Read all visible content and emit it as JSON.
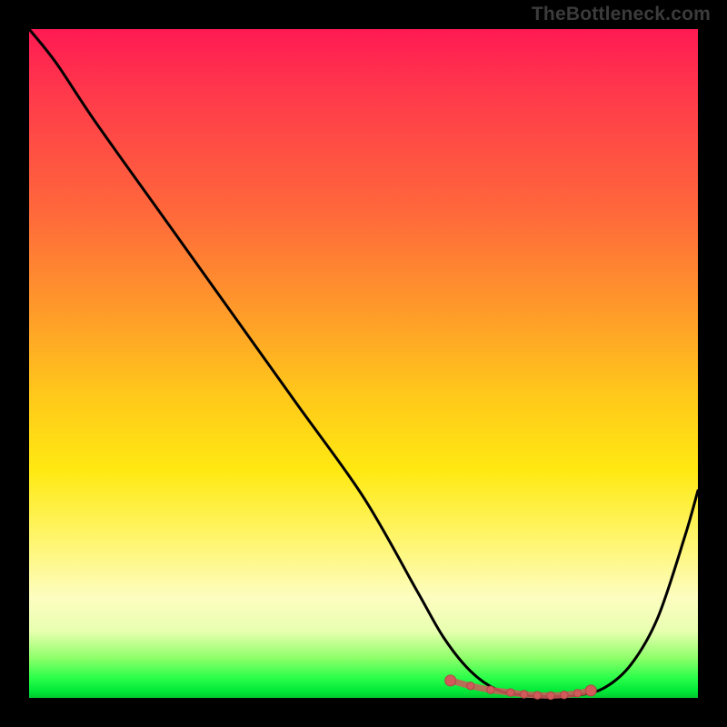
{
  "watermark": "TheBottleneck.com",
  "colors": {
    "page_bg": "#000000",
    "curve": "#000000",
    "marker_fill": "#d15a5a",
    "marker_stroke": "#b04646",
    "gradient_top": "#ff1a53",
    "gradient_bottom": "#00c830"
  },
  "chart_data": {
    "type": "line",
    "title": "",
    "xlabel": "",
    "ylabel": "",
    "xlim": [
      0,
      100
    ],
    "ylim": [
      0,
      100
    ],
    "grid": false,
    "legend": false,
    "series": [
      {
        "name": "bottleneck-curve",
        "x": [
          0,
          4,
          10,
          20,
          30,
          40,
          50,
          58,
          62,
          66,
          70,
          74,
          78,
          82,
          86,
          90,
          94,
          98,
          100
        ],
        "values": [
          100,
          95,
          86,
          72,
          58,
          44,
          30,
          16,
          9,
          4,
          1.2,
          0.4,
          0.2,
          0.4,
          1.5,
          5,
          12,
          24,
          31
        ]
      }
    ],
    "optimal_markers": {
      "name": "optimal-zone",
      "x": [
        63,
        66,
        69,
        72,
        74,
        76,
        78,
        80,
        82,
        84
      ],
      "values": [
        2.6,
        1.8,
        1.2,
        0.8,
        0.55,
        0.4,
        0.35,
        0.45,
        0.7,
        1.1
      ]
    }
  }
}
